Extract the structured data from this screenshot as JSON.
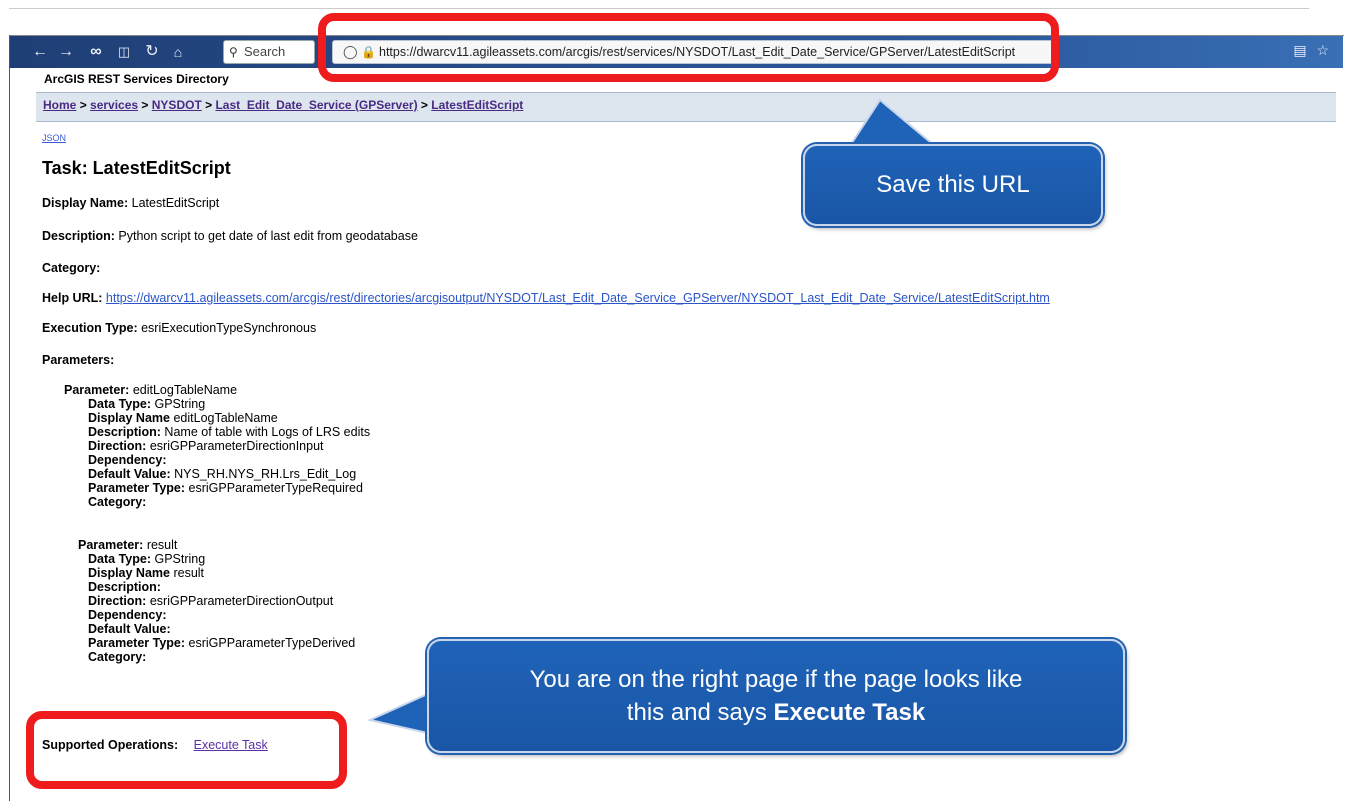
{
  "browser": {
    "search_placeholder": "Search",
    "url": "https://dwarcv11.agileassets.com/arcgis/rest/services/NYSDOT/Last_Edit_Date_Service/GPServer/LatestEditScript"
  },
  "page": {
    "directory_title": "ArcGIS REST Services Directory",
    "breadcrumb": {
      "home": "Home",
      "services": "services",
      "nysdot": "NYSDOT",
      "service": "Last_Edit_Date_Service (GPServer)",
      "task": "LatestEditScript"
    },
    "json_link": "JSON",
    "title": "Task: LatestEditScript",
    "display_name_label": "Display Name:",
    "display_name": "LatestEditScript",
    "description_label": "Description:",
    "description": "Python script to get date of last edit from geodatabase",
    "category_label": "Category:",
    "help_url_label": "Help URL:",
    "help_url": "https://dwarcv11.agileassets.com/arcgis/rest/directories/arcgisoutput/NYSDOT/Last_Edit_Date_Service_GPServer/NYSDOT_Last_Edit_Date_Service/LatestEditScript.htm",
    "execution_type_label": "Execution Type:",
    "execution_type": "esriExecutionTypeSynchronous",
    "parameters_label": "Parameters:",
    "parameters": [
      {
        "name": "editLogTableName",
        "data_type": "GPString",
        "display_name": "editLogTableName",
        "description": "Name of table with Logs of LRS edits",
        "direction": "esriGPParameterDirectionInput",
        "dependency": "",
        "default_value": "NYS_RH.NYS_RH.Lrs_Edit_Log",
        "parameter_type": "esriGPParameterTypeRequired",
        "category": ""
      },
      {
        "name": "result",
        "data_type": "GPString",
        "display_name": "result",
        "description": "",
        "direction": "esriGPParameterDirectionOutput",
        "dependency": "",
        "default_value": "",
        "parameter_type": "esriGPParameterTypeDerived",
        "category": ""
      }
    ],
    "labels": {
      "parameter": "Parameter:",
      "data_type": "Data Type:",
      "display_name": "Display Name",
      "description": "Description:",
      "direction": "Direction:",
      "dependency": "Dependency:",
      "default_value": "Default Value:",
      "parameter_type": "Parameter Type:",
      "category": "Category:"
    },
    "supported_operations_label": "Supported Operations:",
    "execute_task": "Execute Task"
  },
  "annotations": {
    "save_url_callout": "Save this URL",
    "task_callout_line1": "You are on the right page if the page looks like",
    "task_callout_line2_prefix": "this and says ",
    "task_callout_line2_bold": "Execute Task",
    "highlight_color": "#ee1c1c",
    "callout_color": "#1f63b8"
  }
}
